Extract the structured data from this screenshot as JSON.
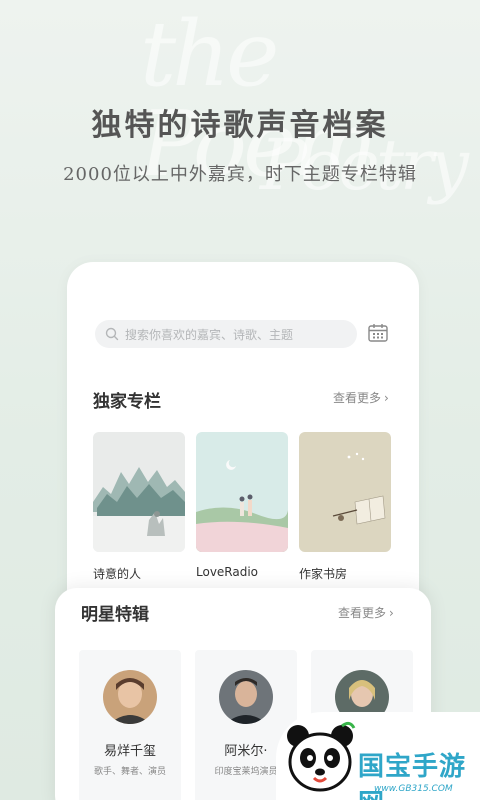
{
  "background": {
    "watermark_text": [
      "the Poem",
      "Poetry"
    ]
  },
  "headline": "独特的诗歌声音档案",
  "subline": "2000位以上中外嘉宾，时下主题专栏特辑",
  "search": {
    "placeholder": "搜索你喜欢的嘉宾、诗歌、主题"
  },
  "exclusive": {
    "title": "独家专栏",
    "more_label": "查看更多",
    "items": [
      {
        "label": "诗意的人"
      },
      {
        "label": "LoveRadio"
      },
      {
        "label": "作家书房"
      }
    ]
  },
  "stars": {
    "title": "明星特辑",
    "more_label": "查看更多",
    "items": [
      {
        "name": "易烊千玺",
        "role": "歌手、舞者、演员"
      },
      {
        "name": "阿米尔·",
        "role": "印度宝莱坞演员"
      },
      {
        "name": "",
        "role": ""
      }
    ]
  },
  "badge": {
    "text": "国宝手游网",
    "url": "www.GB315.COM"
  },
  "colors": {
    "accent_blue": "#2fa6c8",
    "background_green": "#e3ede6"
  }
}
